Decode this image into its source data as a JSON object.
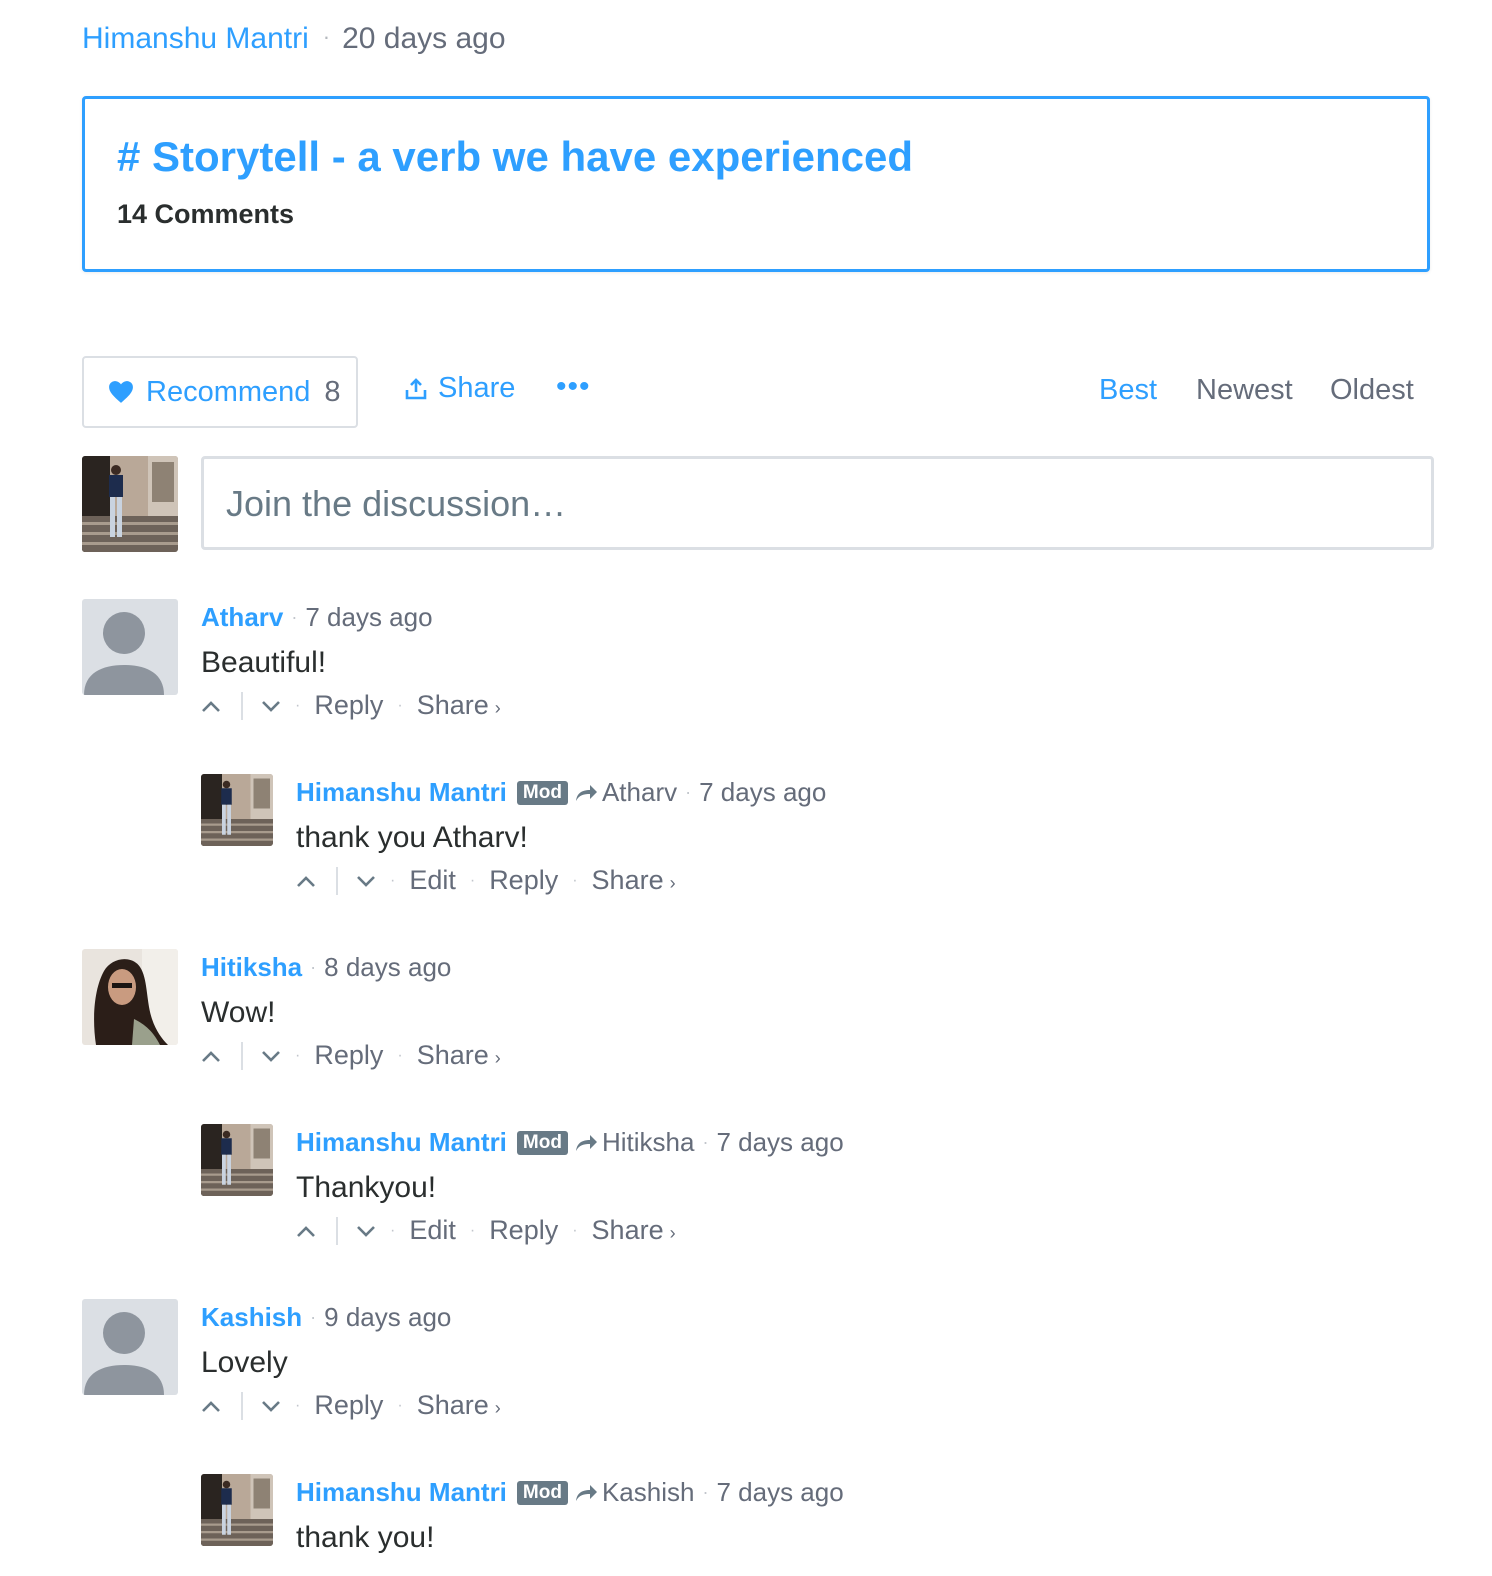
{
  "header": {
    "author": "Himanshu Mantri",
    "separator": "·",
    "time": "20 days ago"
  },
  "thread": {
    "title": "# Storytell - a verb we have experienced",
    "comment_count": "14 Comments"
  },
  "toolbar": {
    "recommend_label": "Recommend",
    "recommend_count": "8",
    "share_label": "Share",
    "more_label": "•••",
    "sort_tabs": [
      "Best",
      "Newest",
      "Oldest"
    ],
    "active_sort": "Best"
  },
  "composer": {
    "placeholder": "Join the discussion…"
  },
  "actions": {
    "edit": "Edit",
    "reply": "Reply",
    "share": "Share",
    "share_chevron": "›",
    "dot": "·"
  },
  "badges": {
    "mod": "Mod"
  },
  "comments": [
    {
      "author": "Atharv",
      "time": "7 days ago",
      "text": "Beautiful!",
      "avatar": "default-avatar"
    },
    {
      "author": "Himanshu Mantri",
      "badge": "Mod",
      "reply_to": "Atharv",
      "time": "7 days ago",
      "text": "thank you Atharv!",
      "avatar": "photo-avatar"
    },
    {
      "author": "Hitiksha",
      "time": "8 days ago",
      "text": "Wow!",
      "avatar": "photo-avatar"
    },
    {
      "author": "Himanshu Mantri",
      "badge": "Mod",
      "reply_to": "Hitiksha",
      "time": "7 days ago",
      "text": "Thankyou!",
      "avatar": "photo-avatar"
    },
    {
      "author": "Kashish",
      "time": "9 days ago",
      "text": "Lovely",
      "avatar": "default-avatar"
    },
    {
      "author": "Himanshu Mantri",
      "badge": "Mod",
      "reply_to": "Kashish",
      "time": "7 days ago",
      "text": "thank you!",
      "avatar": "photo-avatar"
    }
  ],
  "colors": {
    "accent": "#2e9fff",
    "muted_text": "#656c7a",
    "body_text": "#2a2e2e",
    "border": "#dbdfe4",
    "mod_badge": "#687a86"
  }
}
